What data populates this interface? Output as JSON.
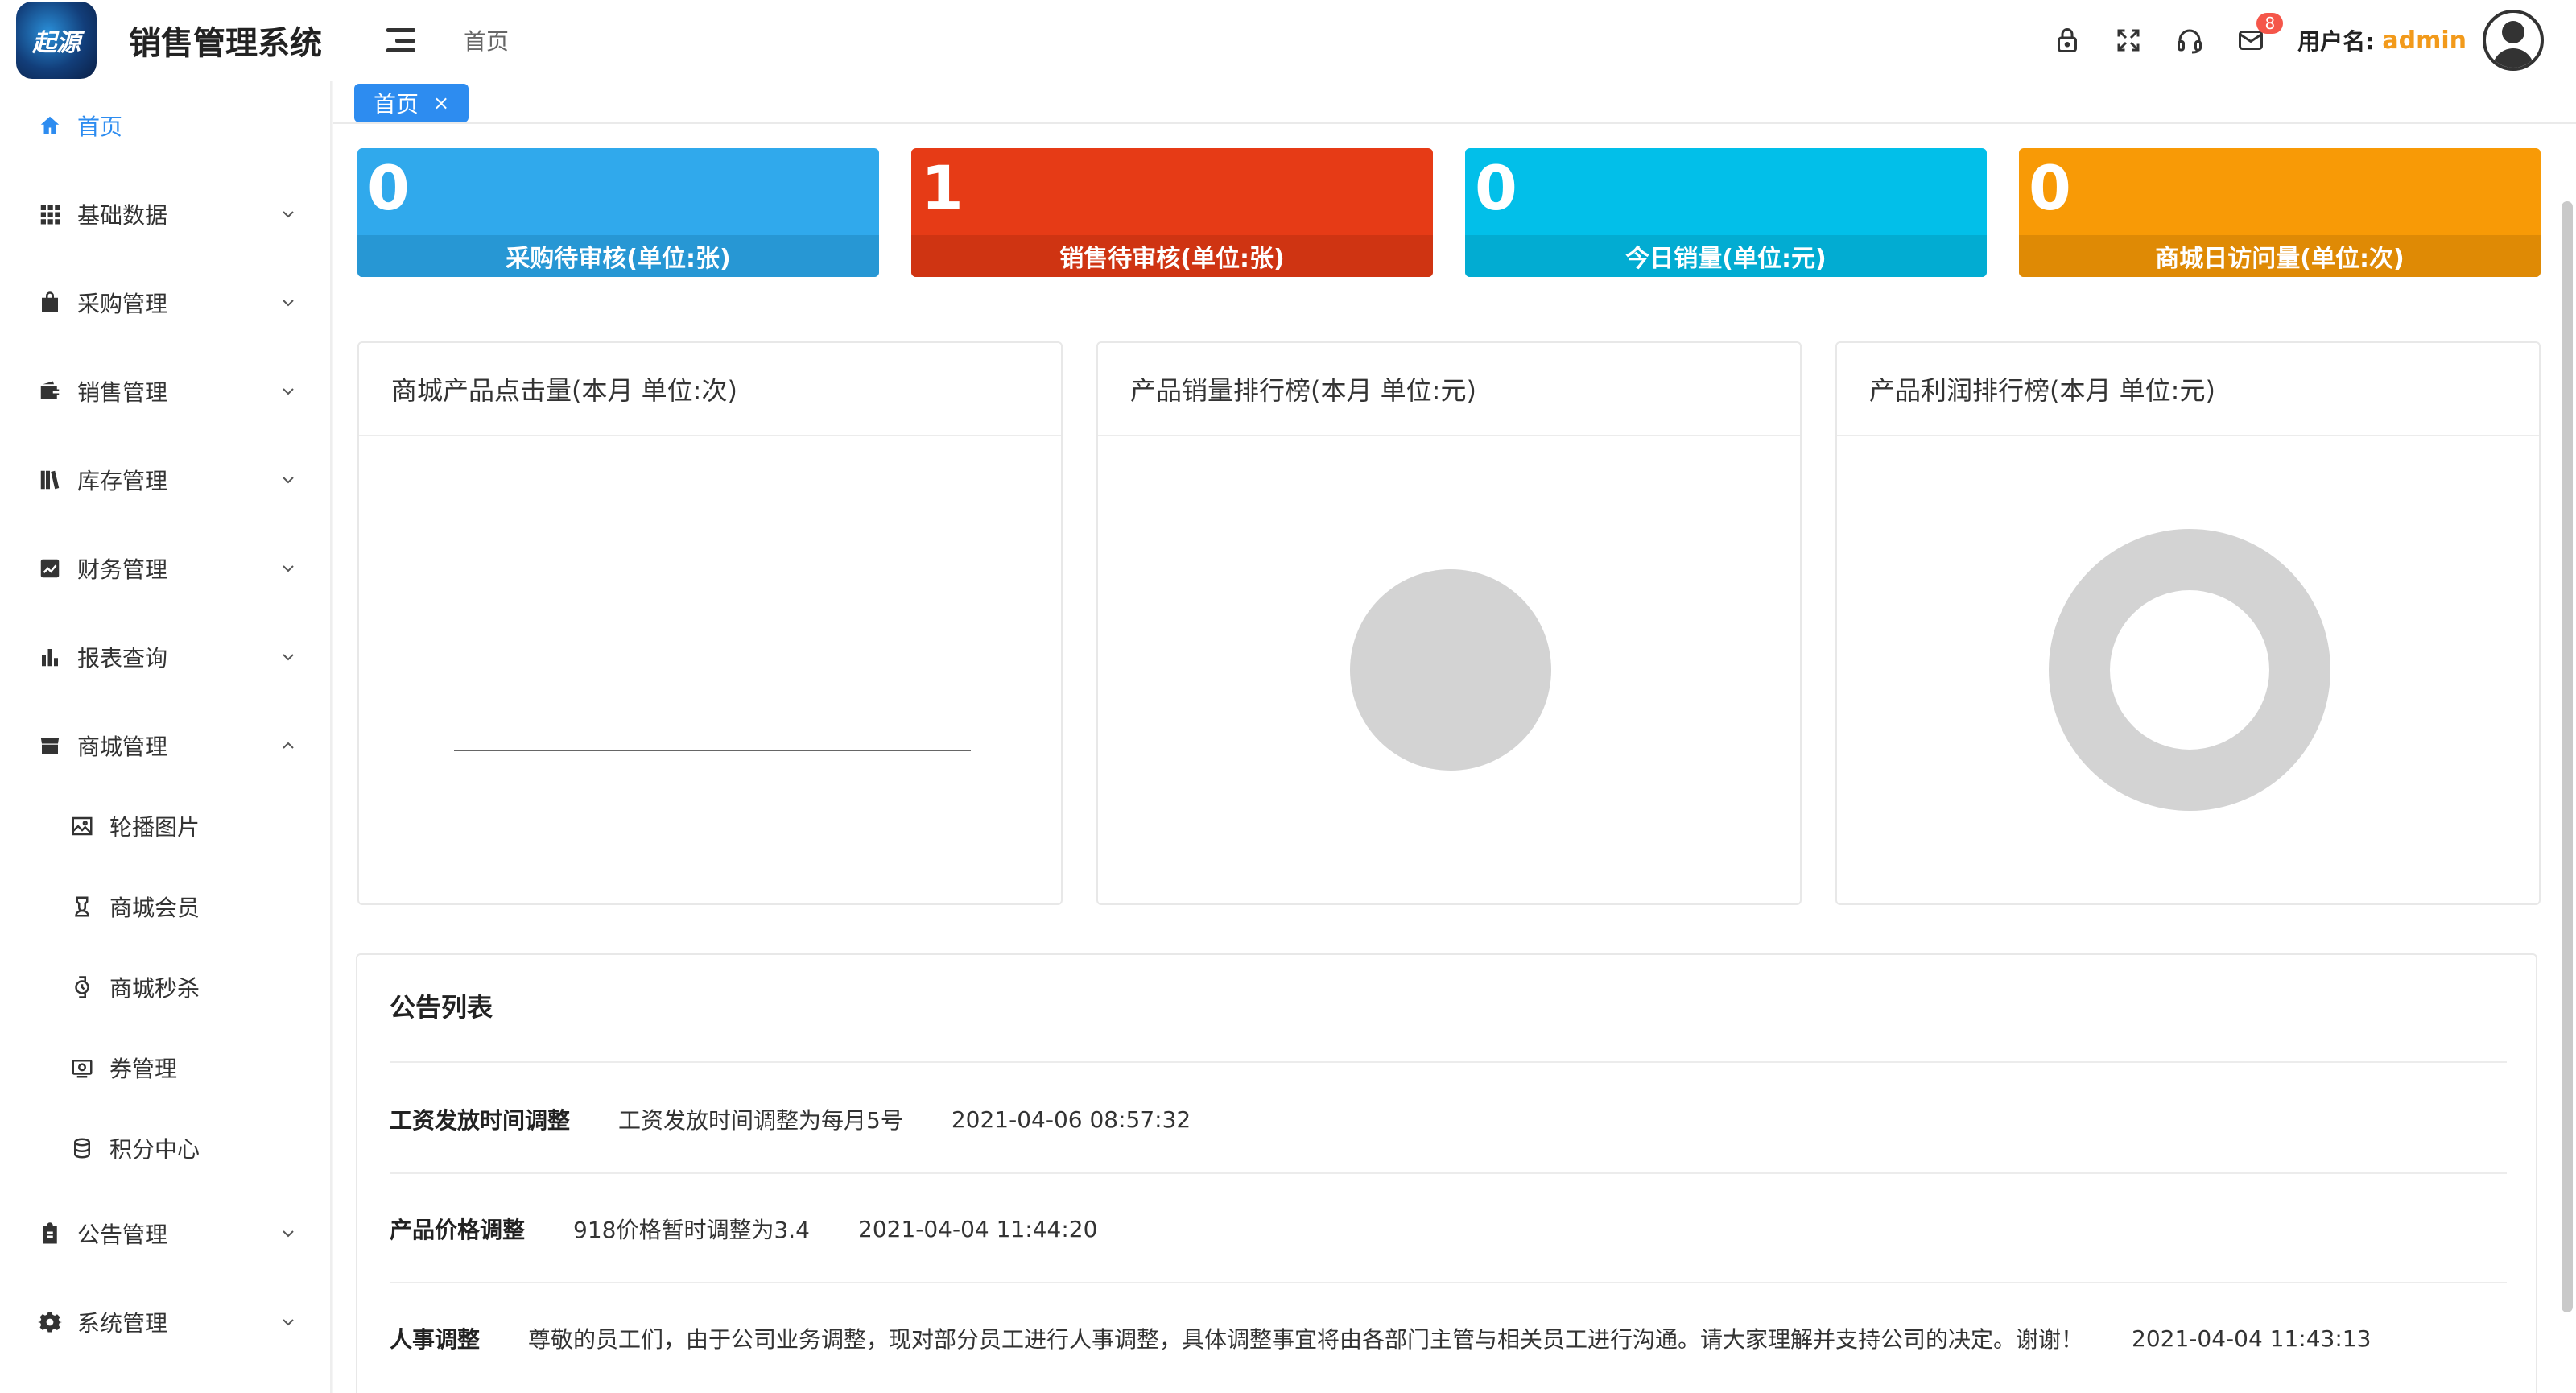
{
  "header": {
    "logo_text": "起源",
    "app_title": "销售管理系统",
    "breadcrumb": "首页",
    "mail_badge": "8",
    "user_label": "用户名:",
    "user_name": "admin"
  },
  "sidebar": {
    "items": [
      {
        "label": "首页",
        "icon": "home-icon",
        "active": true
      },
      {
        "label": "基础数据",
        "icon": "grid-icon"
      },
      {
        "label": "采购管理",
        "icon": "bag-icon"
      },
      {
        "label": "销售管理",
        "icon": "wallet-icon"
      },
      {
        "label": "库存管理",
        "icon": "books-icon"
      },
      {
        "label": "财务管理",
        "icon": "line-chart-icon"
      },
      {
        "label": "报表查询",
        "icon": "bar-chart-icon"
      },
      {
        "label": "商城管理",
        "icon": "store-icon",
        "expanded": true
      },
      {
        "label": "轮播图片",
        "icon": "image-icon",
        "sub": true
      },
      {
        "label": "商城会员",
        "icon": "member-icon",
        "sub": true
      },
      {
        "label": "商城秒杀",
        "icon": "watch-icon",
        "sub": true
      },
      {
        "label": "券管理",
        "icon": "coupon-icon",
        "sub": true
      },
      {
        "label": "积分中心",
        "icon": "coins-icon",
        "sub": true
      },
      {
        "label": "公告管理",
        "icon": "clipboard-icon"
      },
      {
        "label": "系统管理",
        "icon": "gear-icon"
      }
    ]
  },
  "tabs": [
    {
      "label": "首页",
      "close": "×"
    }
  ],
  "stats": [
    {
      "value": "0",
      "caption": "采购待审核(单位:张)",
      "color": "#30a9ec"
    },
    {
      "value": "1",
      "caption": "销售待审核(单位:张)",
      "color": "#e63b16"
    },
    {
      "value": "0",
      "caption": "今日销量(单位:元)",
      "color": "#02bfe9"
    },
    {
      "value": "0",
      "caption": "商城日访问量(单位:次)",
      "color": "#f89a06"
    }
  ],
  "charts": {
    "clicks": {
      "title": "商城产品点击量(本月 单位:次)"
    },
    "sales_rank": {
      "title": "产品销量排行榜(本月 单位:元)"
    },
    "profit_rank": {
      "title": "产品利润排行榜(本月 单位:元)"
    }
  },
  "notice": {
    "title": "公告列表",
    "rows": [
      {
        "title": "工资发放时间调整",
        "content": "工资发放时间调整为每月5号",
        "date": "2021-04-06 08:57:32"
      },
      {
        "title": "产品价格调整",
        "content": "918价格暂时调整为3.4",
        "date": "2021-04-04 11:44:20"
      },
      {
        "title": "人事调整",
        "content": "尊敬的员工们，由于公司业务调整，现对部分员工进行人事调整，具体调整事宜将由各部门主管与相关员工进行沟通。请大家理解并支持公司的决定。谢谢！",
        "date": "2021-04-04 11:43:13"
      }
    ]
  }
}
